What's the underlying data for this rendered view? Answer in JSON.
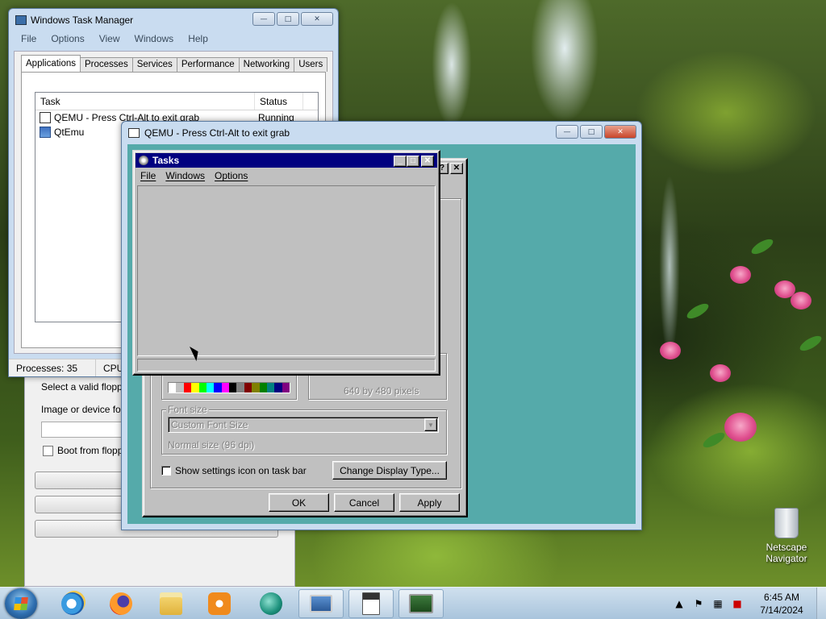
{
  "desktop": {
    "icons": [
      {
        "label": "Netscape Navigator",
        "icon": "recycle-bin-icon"
      }
    ]
  },
  "task_manager": {
    "title": "Windows Task Manager",
    "menu": [
      "File",
      "Options",
      "View",
      "Windows",
      "Help"
    ],
    "tabs": [
      "Applications",
      "Processes",
      "Services",
      "Performance",
      "Networking",
      "Users"
    ],
    "active_tab": "Applications",
    "columns": {
      "task": "Task",
      "status": "Status"
    },
    "rows": [
      {
        "task": "QEMU - Press Ctrl-Alt to exit grab",
        "status": "Running"
      },
      {
        "task": "QtEmu",
        "status": ""
      }
    ],
    "status": {
      "processes": "Processes: 35",
      "cpu": "CPU"
    }
  },
  "qtemu": {
    "floppy_label": "Select a valid floppy",
    "image_label": "Image or device for",
    "boot_floppy_label": "Boot from floppy"
  },
  "qemu": {
    "title": "QEMU - Press Ctrl-Alt to exit grab",
    "background_color": "#55aaaa"
  },
  "display_properties": {
    "screen_area_text": "640 by 480 pixels",
    "font_size_label": "Font size",
    "font_size_value": "Custom Font Size",
    "font_size_note": "Normal size (96 dpi)",
    "show_icon_label": "Show settings icon on task bar",
    "change_display_button": "Change Display Type...",
    "ok_button": "OK",
    "cancel_button": "Cancel",
    "apply_button": "Apply",
    "help_cap": "?",
    "close_cap": "✕",
    "palette": [
      "#ffffff",
      "#c0c0c0",
      "#ff0000",
      "#ffff00",
      "#00ff00",
      "#00ffff",
      "#0000ff",
      "#ff00ff",
      "#000000",
      "#808080",
      "#800000",
      "#808000",
      "#008000",
      "#008080",
      "#000080",
      "#800080"
    ]
  },
  "tasks_window": {
    "title": "Tasks",
    "menu": [
      "File",
      "Windows",
      "Options"
    ]
  },
  "taskbar": {
    "pinned": [
      "internet-explorer-icon",
      "firefox-icon",
      "file-explorer-icon",
      "media-player-icon",
      "qtemu-icon"
    ],
    "open": [
      "qemu-display-icon",
      "document-icon",
      "task-manager-icon"
    ],
    "clock_time": "6:45 AM",
    "clock_date": "7/14/2024"
  }
}
